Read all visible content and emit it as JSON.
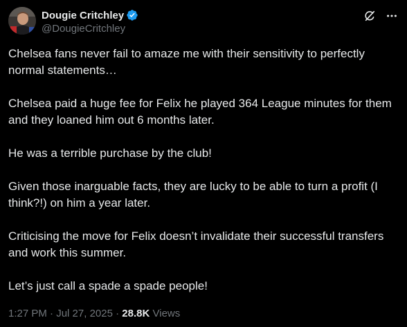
{
  "author": {
    "display_name": "Dougie Critchley",
    "handle": "@DougieCritchley",
    "verified_color": "#1d9bf0"
  },
  "header_icons": [
    "grok-icon",
    "more-options-icon"
  ],
  "paragraphs": [
    "Chelsea fans never fail to amaze me with their sensitivity to perfectly normal statements…",
    "Chelsea paid a huge fee for Felix he played 364 League minutes for them and they loaned him out 6 months later.",
    "He was a terrible purchase by the club!",
    "Given those inarguable facts, they are lucky to be able to turn a profit (I think?!) on him a year later.",
    "Criticising the move for Felix doesn’t invalidate their successful transfers and work this summer.",
    "Let’s just call a spade a spade people!"
  ],
  "meta": {
    "time": "1:27 PM",
    "separator": "·",
    "date": "Jul 27, 2025",
    "views_count": "28.8K",
    "views_label": "Views"
  }
}
